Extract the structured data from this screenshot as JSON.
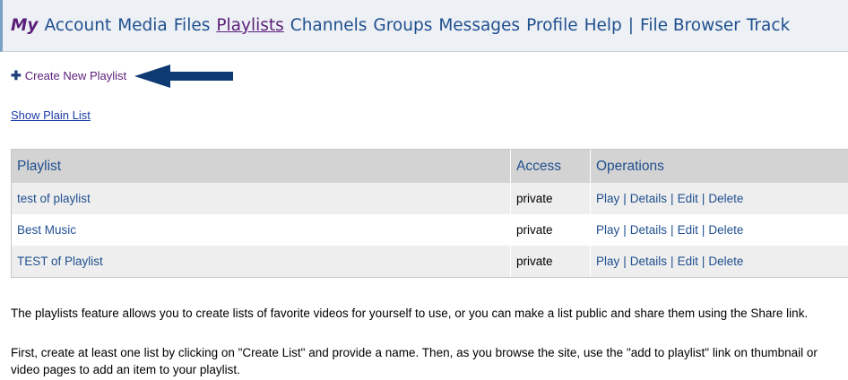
{
  "nav": {
    "my": "My",
    "items": [
      "Account",
      "Media",
      "Files",
      "Playlists",
      "Channels",
      "Groups",
      "Messages",
      "Profile",
      "Help"
    ],
    "separator": "|",
    "extra": [
      "File Browser",
      "Track"
    ],
    "active": "Playlists"
  },
  "actions": {
    "create_label": "Create New Playlist",
    "plain_list_label": "Show Plain List"
  },
  "table": {
    "headers": [
      "Playlist",
      "Access",
      "Operations"
    ],
    "rows": [
      {
        "name": "test of playlist",
        "access": "private"
      },
      {
        "name": "Best Music",
        "access": "private"
      },
      {
        "name": "TEST of Playlist",
        "access": "private"
      }
    ],
    "operations": [
      "Play",
      "Details",
      "Edit",
      "Delete"
    ]
  },
  "info": {
    "p1": "The playlists feature allows you to create lists of favorite videos for yourself to use, or you can make a list public and share them using the Share link.",
    "p2_line1": "First, create at least one list by clicking on \"Create List\" and provide a name. Then, as you browse the site, use the \"add to playlist\" link on thumbnail or",
    "p2_line2": "video pages to add an item to your playlist."
  },
  "colors": {
    "link": "#1f4f8f",
    "visited": "#5b1f7a",
    "arrow": "#0d3a73",
    "header_bg": "#d3d3d3",
    "row_alt_bg": "#eeeeee"
  }
}
